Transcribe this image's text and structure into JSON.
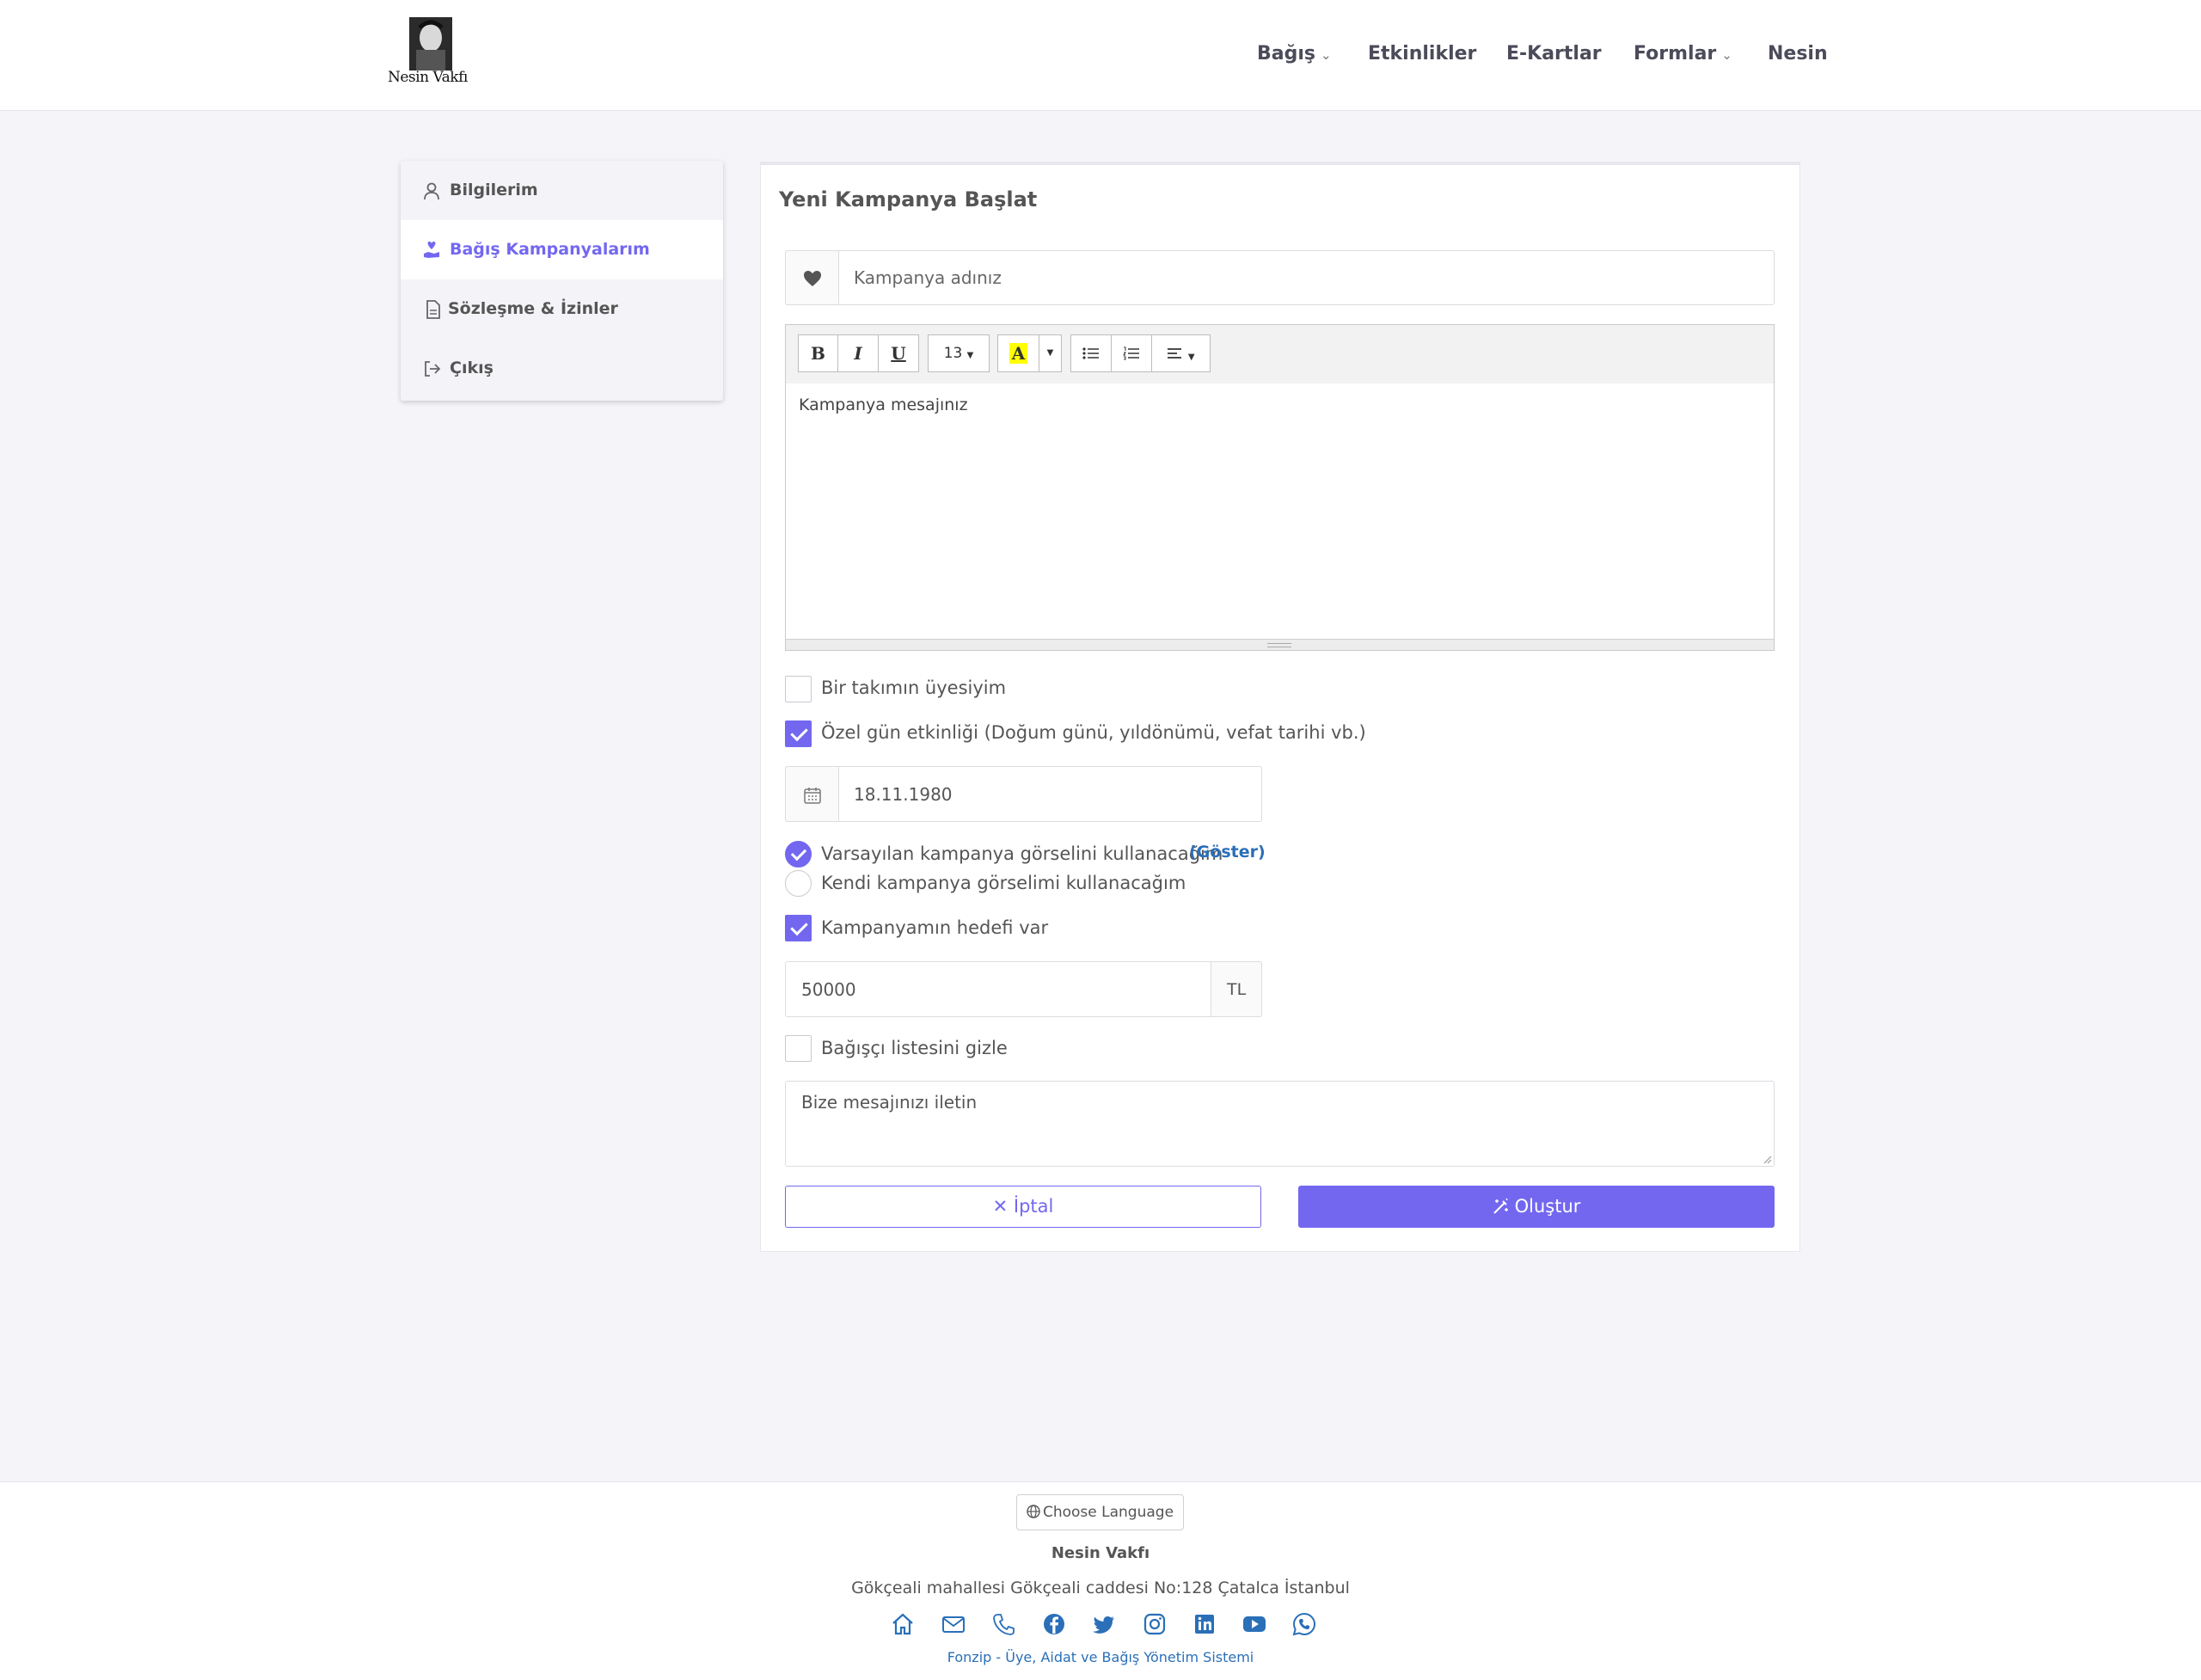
{
  "brand": {
    "logo_text": "Nesin Vakfı"
  },
  "nav": {
    "items": [
      {
        "label": "Bağış",
        "dropdown": true
      },
      {
        "label": "Etkinlikler",
        "dropdown": false
      },
      {
        "label": "E-Kartlar",
        "dropdown": false
      },
      {
        "label": "Formlar",
        "dropdown": true
      },
      {
        "label": "Nesin",
        "dropdown": false
      }
    ]
  },
  "sidebar": {
    "items": [
      {
        "label": "Bilgilerim",
        "icon": "user-icon",
        "active": false
      },
      {
        "label": "Bağış Kampanyalarım",
        "icon": "hand-heart-icon",
        "active": true
      },
      {
        "label": "Sözleşme & İzinler",
        "icon": "document-icon",
        "active": false
      },
      {
        "label": "Çıkış",
        "icon": "logout-icon",
        "active": false
      }
    ]
  },
  "form": {
    "title": "Yeni Kampanya Başlat",
    "campaign_name": {
      "placeholder": "Kampanya adınız",
      "value": "",
      "icon": "heart-icon"
    },
    "editor": {
      "toolbar": {
        "bold": "B",
        "italic": "I",
        "underline": "U",
        "font_size": "13",
        "highlight": "A"
      },
      "placeholder": "Kampanya mesajınız"
    },
    "team_member": {
      "label": "Bir takımın üyesiyim",
      "checked": false
    },
    "special_day": {
      "label": "Özel gün etkinliği (Doğum günü, yıldönümü, vefat tarihi vb.)",
      "checked": true
    },
    "date": {
      "value": "18.11.1980",
      "icon": "calendar-icon"
    },
    "image_default": {
      "label": "Varsayılan kampanya görselini kullanacağım",
      "selected": true,
      "link": "(Göster)"
    },
    "image_own": {
      "label": "Kendi kampanya görselimi kullanacağım",
      "selected": false
    },
    "has_goal": {
      "label": "Kampanyamın hedefi var",
      "checked": true
    },
    "goal": {
      "value": "50000",
      "currency": "TL"
    },
    "hide_donors": {
      "label": "Bağışçı listesini gizle",
      "checked": false
    },
    "message": {
      "placeholder": "Bize mesajınızı iletin"
    },
    "cancel_label": "✕ İptal",
    "create_label": "Oluştur"
  },
  "footer": {
    "language_button": "Choose Language",
    "org_name": "Nesin Vakfı",
    "address": "Gökçeali mahallesi Gökçeali caddesi No:128 Çatalca İstanbul",
    "social_icons": [
      "home-icon",
      "mail-icon",
      "phone-icon",
      "facebook-icon",
      "twitter-icon",
      "instagram-icon",
      "linkedin-icon",
      "youtube-icon",
      "whatsapp-icon"
    ],
    "brand_link": "Fonzip - Üye, Aidat ve Bağış Yönetim Sistemi"
  },
  "colors": {
    "accent": "#7367f0",
    "link": "#2a6fb8",
    "background": "#f5f5f9"
  }
}
